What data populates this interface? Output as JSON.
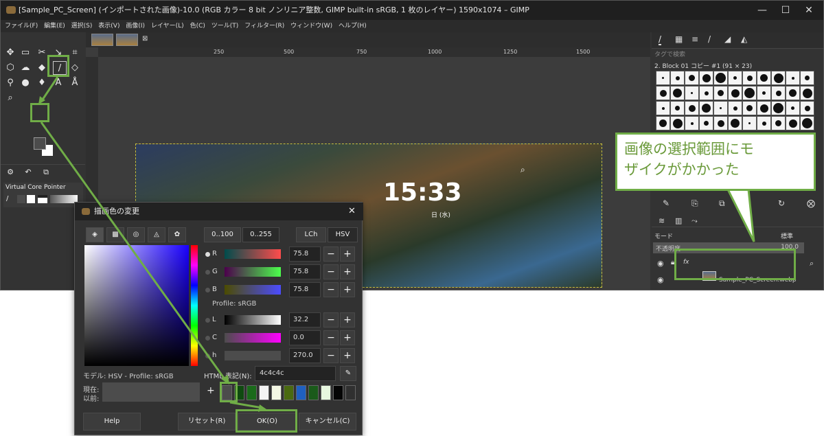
{
  "titlebar": {
    "title": "[Sample_PC_Screen] (インポートされた画像)-10.0 (RGB カラー 8 bit ノンリニア整数, GIMP built-in sRGB, 1 枚のレイヤー) 1590x1074 – GIMP",
    "minimize": "—",
    "maximize": "☐",
    "close": "✕"
  },
  "menu": [
    "ファイル(F)",
    "編集(E)",
    "選択(S)",
    "表示(V)",
    "画像(I)",
    "レイヤー(L)",
    "色(C)",
    "ツール(T)",
    "フィルター(R)",
    "ウィンドウ(W)",
    "ヘルプ(H)"
  ],
  "toolbox": {
    "device_status": "Virtual Core Pointer"
  },
  "ruler": {
    "ticks": [
      "250",
      "500",
      "750",
      "1000",
      "1250",
      "1500"
    ]
  },
  "photo": {
    "clock": "15:33",
    "date": "日 (水)"
  },
  "right_panel": {
    "search_placeholder": "タグで検索",
    "brush_name": "2. Block 01 コピー #1 (91 × 23)",
    "mode_label": "モード",
    "mode_value": "標準",
    "opacity_label": "不透明度",
    "opacity_value": "100.0",
    "layer_name": "Sample_PC_Screen.webp"
  },
  "dialog": {
    "title": "描画色の変更",
    "range_a": "0..100",
    "range_b": "0..255",
    "mode_lch": "LCh",
    "mode_hsv": "HSV",
    "sliders": [
      {
        "label": "R",
        "value": "75.8"
      },
      {
        "label": "G",
        "value": "75.8"
      },
      {
        "label": "B",
        "value": "75.8"
      },
      {
        "label": "L",
        "value": "32.2"
      },
      {
        "label": "C",
        "value": "0.0"
      },
      {
        "label": "h",
        "value": "270.0"
      }
    ],
    "profile": "Profile: sRGB",
    "model_label": "モデル: HSV - Profile: sRGB",
    "html_label": "HTML 表記(N):",
    "html_value": "4c4c4c",
    "current_label": "現在:",
    "previous_label": "以前:",
    "add": "+",
    "btn_help": "Help",
    "btn_reset": "リセット(R)",
    "btn_ok": "OK(O)",
    "btn_cancel": "キャンセル(C)",
    "history_colors": [
      "#4c4c4c",
      "#0f4a10",
      "#1a6a1a",
      "#f4f4f4",
      "#f4f8e4",
      "#4a6a10",
      "#2060c0",
      "#1a5a1a",
      "#e8f8e0",
      "#050505",
      "#303030"
    ]
  },
  "callout": {
    "line1": "画像の選択範囲にモ",
    "line2": "ザイクがかかった"
  },
  "colors": {
    "accent": "#70ad47",
    "fg_color": "#4c4c4c"
  }
}
